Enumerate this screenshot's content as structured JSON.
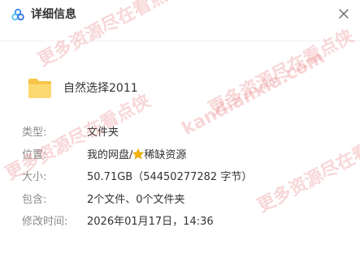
{
  "window": {
    "title": "详细信息",
    "icons": {
      "app": "cloud-logo-icon",
      "close": "close-icon",
      "folder": "folder-icon",
      "star": "star-icon"
    }
  },
  "item": {
    "name": "自然选择2011"
  },
  "details": [
    {
      "label": "类型:",
      "value": "文件夹"
    },
    {
      "label": "位置:",
      "value_prefix": "我的网盘/",
      "value_suffix": "稀缺资源"
    },
    {
      "label": "大小:",
      "value": "50.71GB（54450277282 字节）"
    },
    {
      "label": "包含:",
      "value": "2个文件、0个文件夹"
    },
    {
      "label": "修改时间:",
      "value": "2026年01月17日，14:36"
    }
  ],
  "watermarks": [
    "kandianxia.com",
    "更多资源尽在看点侠"
  ],
  "colors": {
    "accent": "#3a8df5",
    "folder": "#f9cf5f",
    "star": "#f5b400",
    "watermark": "#e66e6e"
  }
}
